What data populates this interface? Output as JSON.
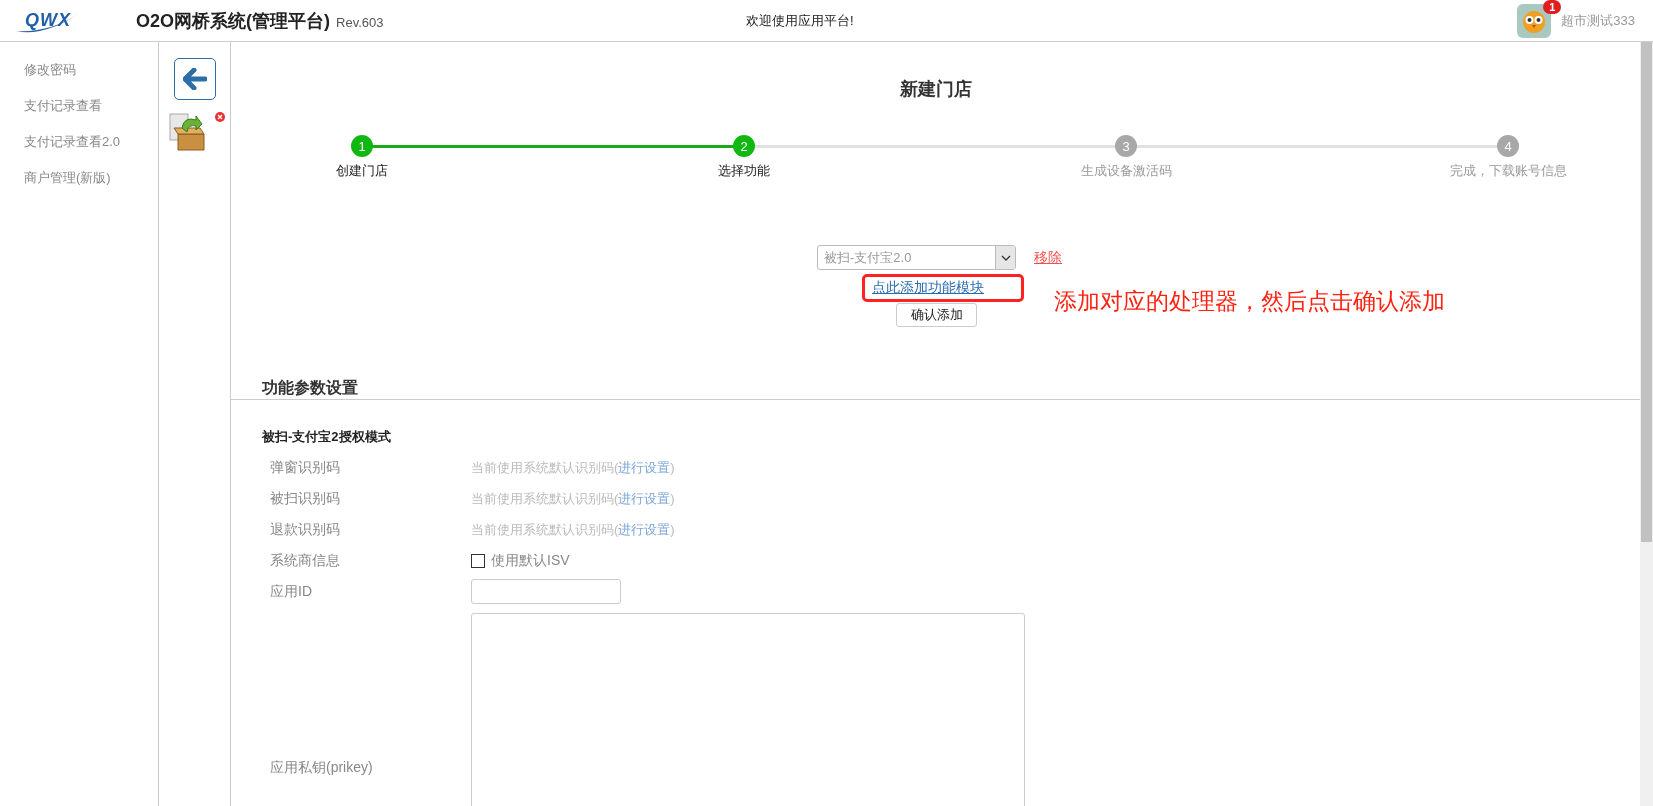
{
  "header": {
    "logo": "QWX",
    "title": "O2O网桥系统(管理平台)",
    "revision": "Rev.603",
    "welcome": "欢迎使用应用平台!",
    "badge": "1",
    "user": "超市测试333"
  },
  "sidebar": {
    "items": [
      {
        "label": "修改密码"
      },
      {
        "label": "支付记录查看"
      },
      {
        "label": "支付记录查看2.0"
      },
      {
        "label": "商户管理(新版)"
      }
    ]
  },
  "page": {
    "title": "新建门店"
  },
  "steps": [
    {
      "number": "1",
      "label": "创建门店",
      "completed": true
    },
    {
      "number": "2",
      "label": "选择功能",
      "completed": true
    },
    {
      "number": "3",
      "label": "生成设备激活码",
      "completed": false
    },
    {
      "number": "4",
      "label": "完成，下载账号信息",
      "completed": false
    }
  ],
  "module_picker": {
    "value": "被扫-支付宝2.0",
    "remove_link": "移除",
    "add_link": "点此添加功能模块",
    "confirm_button": "确认添加",
    "annotation": "添加对应的处理器，然后点击确认添加"
  },
  "settings": {
    "heading": "功能参数设置",
    "subheading": "被扫-支付宝2授权模式",
    "rows": [
      {
        "kind": "code",
        "label": "弹窗识别码",
        "value": "当前使用系统默认识别码(",
        "link": "进行设置",
        "suffix": ")"
      },
      {
        "kind": "code",
        "label": "被扫识别码",
        "value": "当前使用系统默认识别码(",
        "link": "进行设置",
        "suffix": ")"
      },
      {
        "kind": "code",
        "label": "退款识别码",
        "value": "当前使用系统默认识别码(",
        "link": "进行设置",
        "suffix": ")"
      },
      {
        "kind": "checkbox",
        "label": "系统商信息",
        "option": "使用默认ISV",
        "checked": false
      },
      {
        "kind": "input",
        "label": "应用ID"
      },
      {
        "kind": "textarea",
        "label": "应用私钥(prikey)"
      }
    ]
  }
}
